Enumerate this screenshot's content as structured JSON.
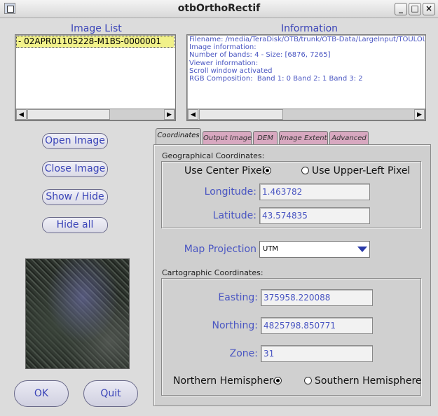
{
  "window": {
    "title": "otbOrthoRectif",
    "minimize_icon": "minimize-icon",
    "maximize_icon": "maximize-icon",
    "close_icon": "close-icon"
  },
  "image_list": {
    "title": "Image List",
    "items": [
      "- 02APR01105228-M1BS-0000001"
    ]
  },
  "information": {
    "title": "Information",
    "lines": [
      "Filename: /media/TeraDisk/OTB/trunk/OTB-Data/LargeInput/TOULOUSE/Q",
      "Image information:",
      "Number of bands: 4 - Size: [6876, 7265]",
      "Viewer information:",
      "Scroll window activated",
      "RGB Composition:  Band 1: 0 Band 2: 1 Band 3: 2"
    ]
  },
  "buttons": {
    "open_image": "Open Image",
    "close_image": "Close Image",
    "show_hide": "Show / Hide",
    "hide_all": "Hide all",
    "ok": "OK",
    "quit": "Quit"
  },
  "tabs": [
    {
      "label": "Coordinates",
      "active": true
    },
    {
      "label": "Output Image",
      "active": false
    },
    {
      "label": "DEM",
      "active": false
    },
    {
      "label": "Image Extent",
      "active": false
    },
    {
      "label": "Advanced",
      "active": false
    }
  ],
  "coordinates": {
    "geo_title": "Geographical Coordinates:",
    "use_center_pixel": "Use Center Pixel",
    "use_upper_left_pixel": "Use Upper-Left Pixel",
    "selected_pixel_mode": "center",
    "longitude_label": "Longitude:",
    "longitude_value": "1.463782",
    "latitude_label": "Latitude:",
    "latitude_value": "43.574835",
    "map_projection_label": "Map Projection",
    "map_projection_value": "UTM",
    "carto_title": "Cartographic Coordinates:",
    "easting_label": "Easting:",
    "easting_value": "375958.220088",
    "northing_label": "Northing:",
    "northing_value": "4825798.850771",
    "zone_label": "Zone:",
    "zone_value": "31",
    "northern_hemisphere": "Northern Hemisphere",
    "southern_hemisphere": "Southern Hemisphere",
    "selected_hemisphere": "northern"
  },
  "colors": {
    "label_blue": "#3a44b8",
    "tab_inactive": "#d8a8c0",
    "list_selection": "#f1f18a"
  }
}
